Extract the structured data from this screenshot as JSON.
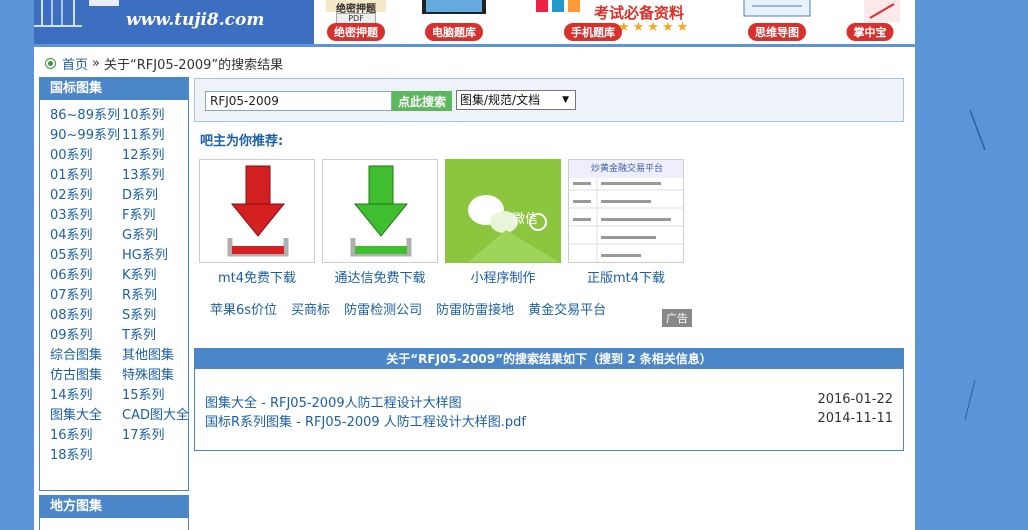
{
  "header": {
    "site_url": "www.tuji8.com",
    "banner_ads": [
      {
        "top_text": "绝密押题",
        "label": "绝密押题"
      },
      {
        "label": "电脑题库"
      },
      {
        "top_text": "考试必备资料",
        "label": "手机题库"
      },
      {
        "label": "思维导图"
      },
      {
        "label": "掌中宝"
      }
    ]
  },
  "breadcrumb": {
    "home": "首页",
    "separator": "»",
    "current": "关于“RFJ05-2009”的搜索结果"
  },
  "sidebar": {
    "national": {
      "title": "国标图集",
      "items": [
        "86~89系列",
        "10系列",
        "90~99系列",
        "11系列",
        "00系列",
        "12系列",
        "01系列",
        "13系列",
        "02系列",
        "D系列",
        "03系列",
        "F系列",
        "04系列",
        "G系列",
        "05系列",
        "HG系列",
        "06系列",
        "K系列",
        "07系列",
        "R系列",
        "08系列",
        "S系列",
        "09系列",
        "T系列",
        "综合图集",
        "其他图集",
        "仿古图集",
        "特殊图集",
        "14系列",
        "15系列",
        "图集大全",
        "CAD图大全",
        "16系列",
        "17系列",
        "18系列"
      ]
    },
    "local": {
      "title": "地方图集"
    }
  },
  "search": {
    "query": "RFJ05-2009",
    "button_label": "点此搜索",
    "scope_selected": "图集/规范/文档"
  },
  "recommend": {
    "title": "吧主为你推荐:",
    "cards": [
      {
        "caption": "mt4免费下载"
      },
      {
        "caption": "通达信免费下载"
      },
      {
        "caption": "小程序制作",
        "img_text": "微信"
      },
      {
        "caption": "正版mt4下载",
        "img_text": "炒黄金融交易平台"
      }
    ],
    "keywords": [
      "苹果6s价位",
      "买商标",
      "防雷检测公司",
      "防雷防雷接地",
      "黄金交易平台"
    ],
    "ad_tag": "广告"
  },
  "results": {
    "header": "关于“RFJ05-2009”的搜索结果如下（搜到 2 条相关信息）",
    "items": [
      {
        "title": "图集大全 - RFJ05-2009人防工程设计大样图",
        "date": "2016-01-22"
      },
      {
        "title": "国标R系列图集 - RFJ05-2009 人防工程设计大样图.pdf",
        "date": "2014-11-11"
      }
    ]
  },
  "colors": {
    "page_bg": "#5b95d8",
    "accent_blue": "#4a86c8",
    "link": "#1a5fa6",
    "search_btn": "#5cb85c"
  }
}
